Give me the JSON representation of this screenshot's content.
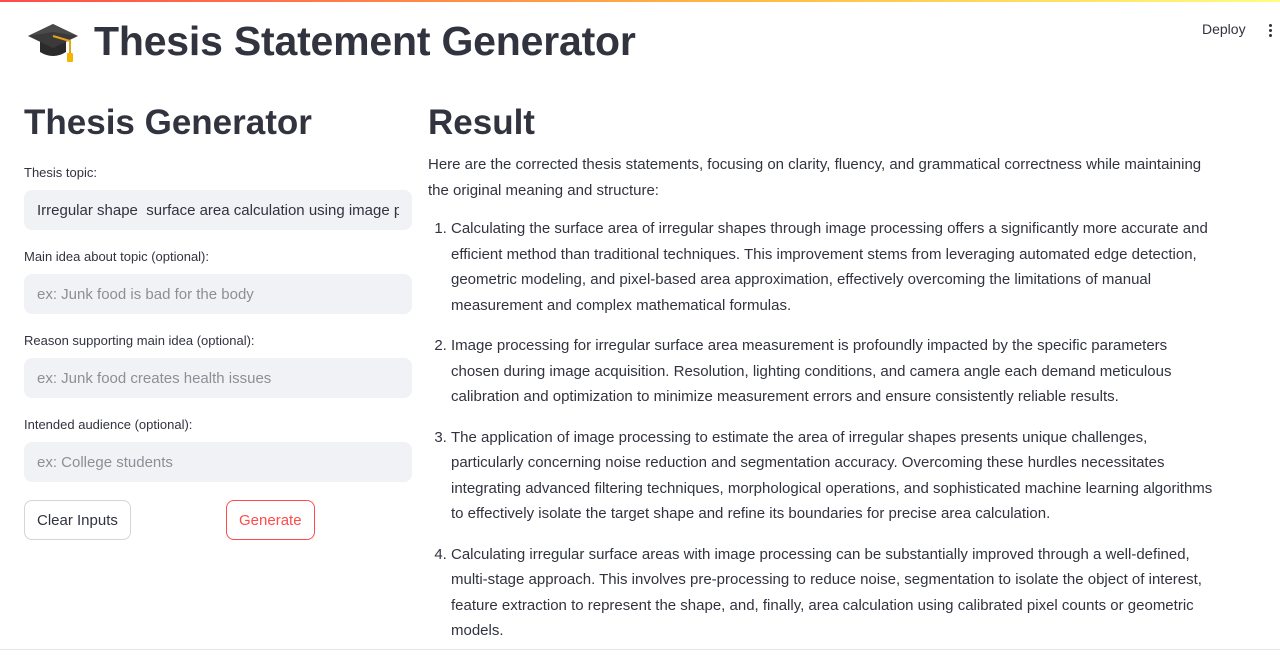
{
  "header": {
    "deploy_label": "Deploy",
    "menu_icon": "kebab-menu-icon"
  },
  "app": {
    "title": "Thesis Statement Generator",
    "title_icon": "graduation-cap-icon"
  },
  "form": {
    "heading": "Thesis Generator",
    "fields": [
      {
        "label": "Thesis topic:",
        "value": "Irregular shape  surface area calculation using image processing",
        "placeholder": ""
      },
      {
        "label": "Main idea about topic (optional):",
        "value": "",
        "placeholder": "ex: Junk food is bad for the body"
      },
      {
        "label": "Reason supporting main idea (optional):",
        "value": "",
        "placeholder": "ex: Junk food creates health issues"
      },
      {
        "label": "Intended audience (optional):",
        "value": "",
        "placeholder": "ex: College students"
      }
    ],
    "clear_label": "Clear Inputs",
    "generate_label": "Generate"
  },
  "result": {
    "heading": "Result",
    "intro": "Here are the corrected thesis statements, focusing on clarity, fluency, and grammatical correctness while maintaining the original meaning and structure:",
    "items": [
      "Calculating the surface area of irregular shapes through image processing offers a significantly more accurate and efficient method than traditional techniques. This improvement stems from leveraging automated edge detection, geometric modeling, and pixel-based area approximation, effectively overcoming the limitations of manual measurement and complex mathematical formulas.",
      "Image processing for irregular surface area measurement is profoundly impacted by the specific parameters chosen during image acquisition. Resolution, lighting conditions, and camera angle each demand meticulous calibration and optimization to minimize measurement errors and ensure consistently reliable results.",
      "The application of image processing to estimate the area of irregular shapes presents unique challenges, particularly concerning noise reduction and segmentation accuracy. Overcoming these hurdles necessitates integrating advanced filtering techniques, morphological operations, and sophisticated machine learning algorithms to effectively isolate the target shape and refine its boundaries for precise area calculation.",
      "Calculating irregular surface areas with image processing can be substantially improved through a well-defined, multi-stage approach. This involves pre-processing to reduce noise, segmentation to isolate the object of interest, feature extraction to represent the shape, and, finally, area calculation using calibrated pixel counts or geometric models."
    ]
  },
  "colors": {
    "accent": "#ff4b4b",
    "text": "#31333f",
    "input_bg": "#f0f2f6"
  }
}
